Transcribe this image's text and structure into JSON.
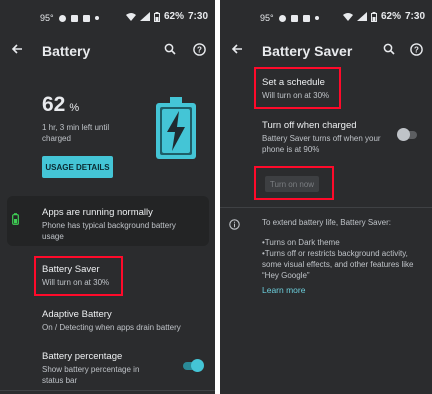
{
  "left": {
    "status": {
      "temp": "95°",
      "percent": "62%",
      "time": "7:30"
    },
    "header": {
      "title": "Battery"
    },
    "battery": {
      "percent_value": "62",
      "percent_sign": "%",
      "time_left_line1": "1 hr, 3 min left until",
      "time_left_line2": "charged",
      "level_fraction": 0.62
    },
    "usage_button": "USAGE DETAILS",
    "status_card": {
      "title": "Apps are running normally",
      "line1": "Phone has typical background battery",
      "line2": "usage"
    },
    "battery_saver": {
      "title": "Battery Saver",
      "subtitle": "Will turn on at 30%"
    },
    "adaptive": {
      "title": "Adaptive Battery",
      "subtitle": "On / Detecting when apps drain battery"
    },
    "percentage": {
      "title": "Battery percentage",
      "line1": "Show battery percentage in",
      "line2": "status bar",
      "enabled": true
    }
  },
  "right": {
    "status": {
      "temp": "95°",
      "percent": "62%",
      "time": "7:30"
    },
    "header": {
      "title": "Battery Saver"
    },
    "schedule": {
      "title": "Set a schedule",
      "subtitle": "Will turn on at 30%"
    },
    "turn_off": {
      "title": "Turn off when charged",
      "line1": "Battery Saver turns off when your",
      "line2": "phone is at 90%",
      "enabled": false
    },
    "turn_on_button": "Turn on now",
    "info": {
      "line1": "To extend battery life, Battery Saver:",
      "bullet1": "•Turns on Dark theme",
      "bullet2_l1": "•Turns off or restricts background activity,",
      "bullet2_l2": "some visual effects, and other features like",
      "bullet2_l3": "“Hey Google”",
      "learn_more": "Learn more"
    }
  },
  "colors": {
    "accent": "#44c5d6",
    "highlight": "#ff0a2a",
    "background": "#2b2c2e",
    "card": "#232425"
  },
  "icons": [
    "back-arrow-icon",
    "search-icon",
    "help-icon",
    "battery-charging-icon",
    "battery-status-icon",
    "info-icon",
    "wifi-icon",
    "signal-icon",
    "battery-small-icon"
  ]
}
